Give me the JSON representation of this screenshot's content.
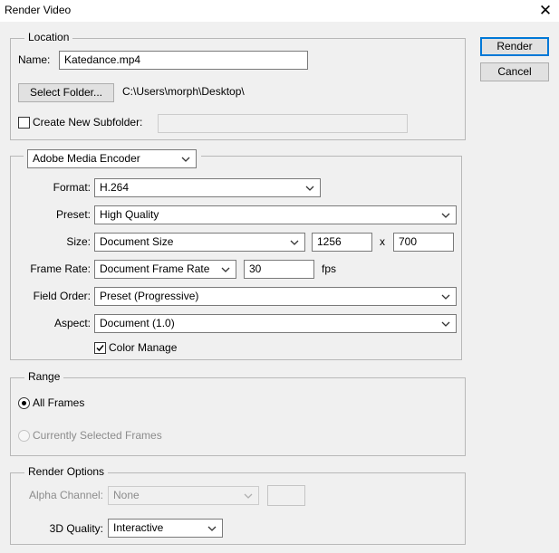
{
  "window": {
    "title": "Render Video",
    "close_icon": "close-icon"
  },
  "buttons": {
    "render": "Render",
    "cancel": "Cancel"
  },
  "location": {
    "legend": "Location",
    "name_label": "Name:",
    "name_value": "Katedance.mp4",
    "select_folder": "Select Folder...",
    "path": "C:\\Users\\morph\\Desktop\\",
    "create_subfolder_label": "Create New Subfolder:",
    "create_subfolder_checked": false,
    "subfolder_value": ""
  },
  "encoder": {
    "selected": "Adobe Media Encoder",
    "format_label": "Format:",
    "format_value": "H.264",
    "preset_label": "Preset:",
    "preset_value": "High Quality",
    "size_label": "Size:",
    "size_value": "Document Size",
    "width": "1256",
    "x_label": "x",
    "height": "700",
    "frame_rate_label": "Frame Rate:",
    "frame_rate_value": "Document Frame Rate",
    "fps_value": "30",
    "fps_label": "fps",
    "field_order_label": "Field Order:",
    "field_order_value": "Preset (Progressive)",
    "aspect_label": "Aspect:",
    "aspect_value": "Document (1.0)",
    "color_manage_label": "Color Manage",
    "color_manage_checked": true
  },
  "range": {
    "legend": "Range",
    "all_frames": "All Frames",
    "current_frames": "Currently Selected Frames",
    "selected": "All Frames"
  },
  "render_options": {
    "legend": "Render Options",
    "alpha_label": "Alpha Channel:",
    "alpha_value": "None",
    "quality_label": "3D Quality:",
    "quality_value": "Interactive"
  },
  "colors": {
    "accent": "#0078d7",
    "background": "#f0f0f0",
    "group_border": "#b8b8b8",
    "disabled_text": "#8c8c8c"
  }
}
